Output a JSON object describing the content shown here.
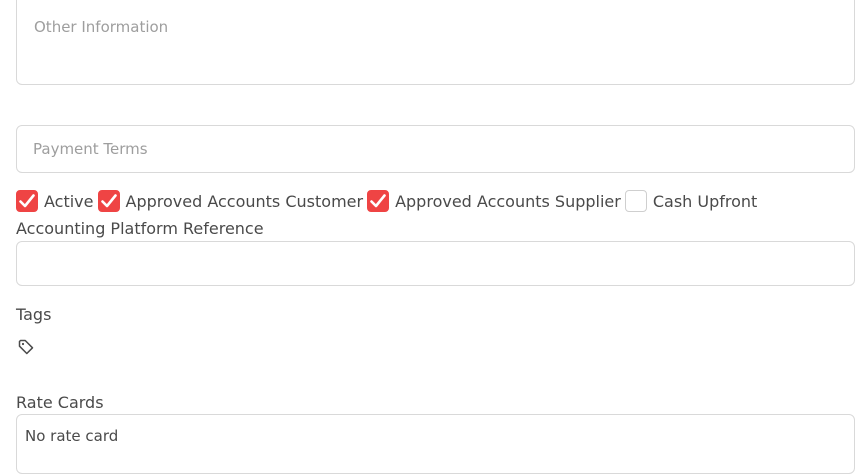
{
  "other_information": {
    "placeholder": "Other Information",
    "value": ""
  },
  "payment_terms": {
    "placeholder": "Payment Terms",
    "value": ""
  },
  "checkboxes": [
    {
      "label": "Active",
      "checked": true
    },
    {
      "label": "Approved Accounts Customer",
      "checked": true
    },
    {
      "label": "Approved Accounts Supplier",
      "checked": true
    },
    {
      "label": "Cash Upfront",
      "checked": false
    }
  ],
  "accounting_platform_reference": {
    "label": "Accounting Platform Reference",
    "value": ""
  },
  "tags": {
    "label": "Tags",
    "icon": "tag-icon"
  },
  "rate_cards": {
    "label": "Rate Cards",
    "value": "No rate card"
  },
  "colors": {
    "accent": "#ef4444",
    "text": "#4a4a4a",
    "placeholder": "#9e9e9e",
    "border": "#d9d9d9"
  }
}
